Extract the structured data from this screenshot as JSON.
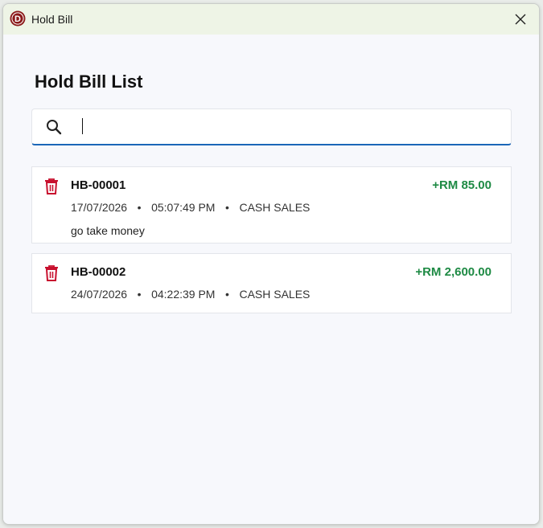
{
  "window": {
    "title": "Hold Bill",
    "logo_letter": "D",
    "logo_color": "#8b1a1a"
  },
  "page": {
    "title": "Hold Bill List"
  },
  "search": {
    "value": "",
    "placeholder": ""
  },
  "colors": {
    "accent": "#1b66b8",
    "amount": "#1e8a44",
    "delete": "#c8102e"
  },
  "bills": [
    {
      "id": "HB-00001",
      "amount": "+RM 85.00",
      "date": "17/07/2026",
      "time": "05:07:49 PM",
      "type": "CASH SALES",
      "note": "go take money",
      "separator": "•"
    },
    {
      "id": "HB-00002",
      "amount": "+RM 2,600.00",
      "date": "24/07/2026",
      "time": "04:22:39 PM",
      "type": "CASH SALES",
      "separator": "•"
    }
  ]
}
